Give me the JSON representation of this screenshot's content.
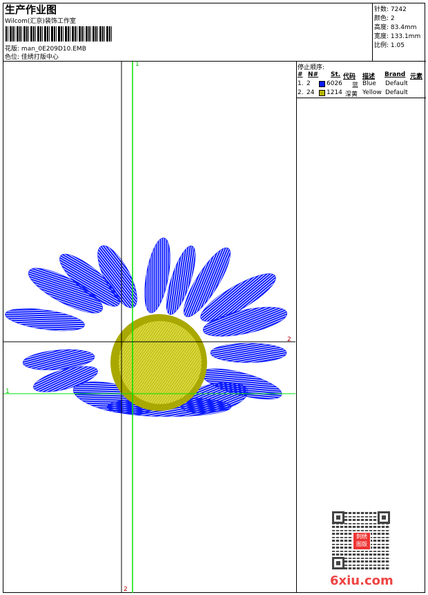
{
  "header": {
    "title": "生产作业图",
    "company": "Wilcom(汇京)装饰工作室",
    "design_label": "花版:",
    "design_value": "man_0E209D10.EMB",
    "color_label": "色位:",
    "color_value": "佳绣打版中心"
  },
  "stats": [
    {
      "label": "针数:",
      "value": "7242"
    },
    {
      "label": "颜色:",
      "value": "2"
    },
    {
      "label": "高度:",
      "value": "83.4mm"
    },
    {
      "label": "宽度:",
      "value": "133.1mm"
    },
    {
      "label": "比例:",
      "value": "1.05"
    }
  ],
  "stop_sequence": {
    "title": "停止顺序:",
    "headers": [
      "#",
      "N#",
      "St.",
      "代码",
      "描述",
      "Brand",
      "元素"
    ],
    "rows": [
      {
        "idx": "1.",
        "n": "2",
        "color": "#0a1aff",
        "st": "6026",
        "code": "蓝",
        "desc": "Blue",
        "brand": "Default"
      },
      {
        "idx": "2.",
        "n": "24",
        "color": "#b5b400",
        "st": "1214",
        "code": "深黄",
        "desc": "Yellow",
        "brand": "Default"
      }
    ]
  },
  "canvas": {
    "green_label": "1",
    "black_label": "2"
  },
  "watermark": {
    "seal": "刺绣图版",
    "brand": "6xiu.com"
  },
  "colors": {
    "blue": "#0a1aff",
    "yellow": "#b5b400",
    "green": "#00e000",
    "red": "#c00000"
  }
}
